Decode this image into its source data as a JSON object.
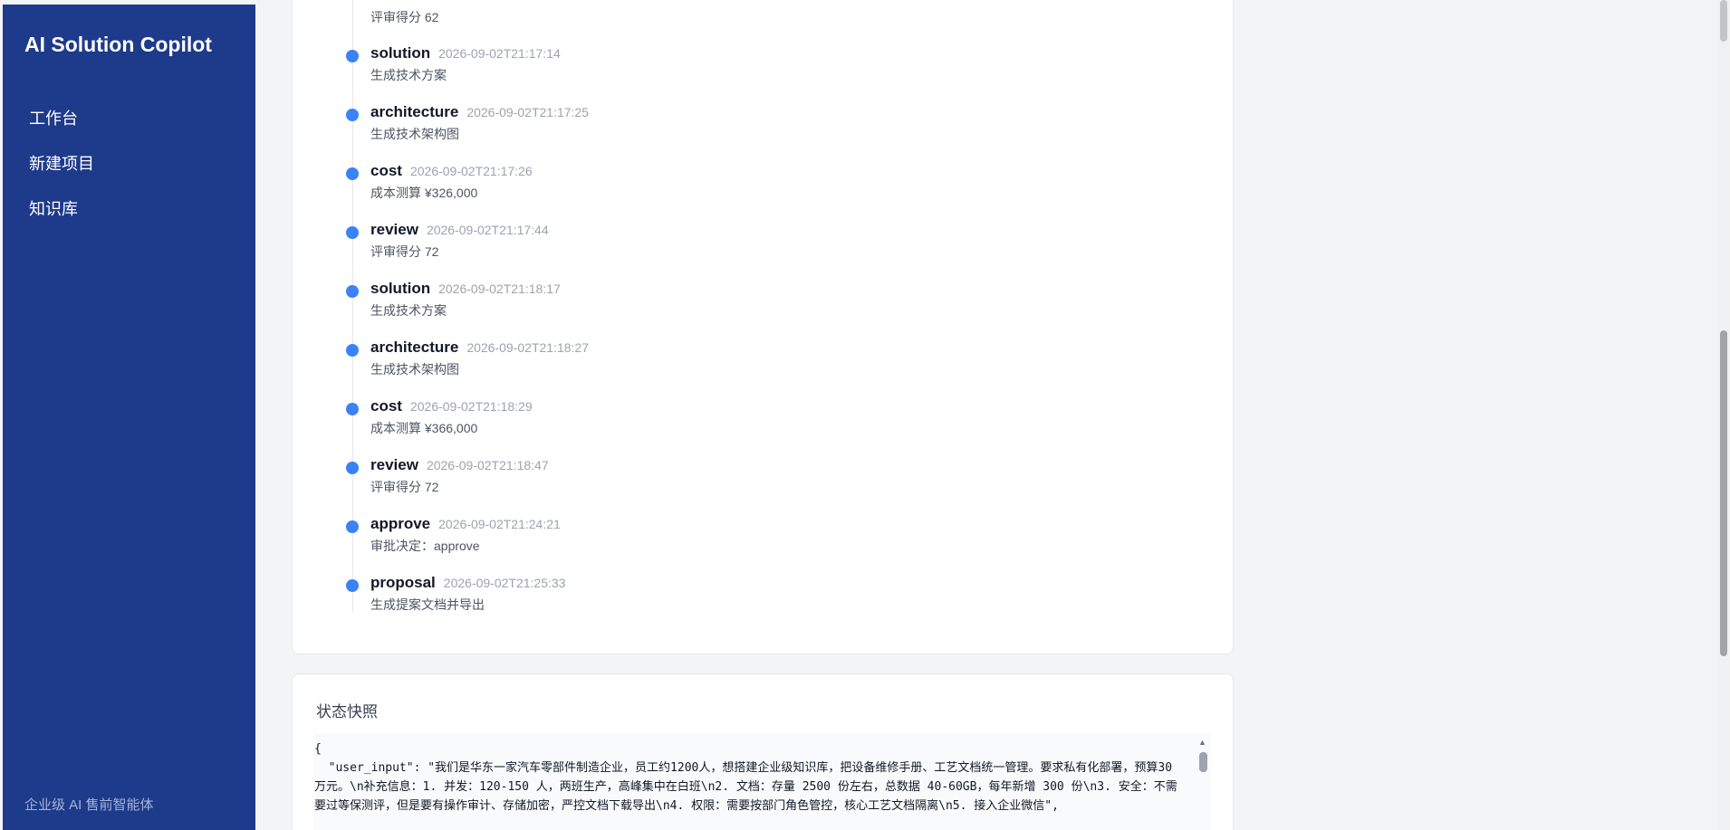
{
  "sidebar": {
    "brand": "AI Solution Copilot",
    "items": [
      {
        "label": "工作台"
      },
      {
        "label": "新建项目"
      },
      {
        "label": "知识库"
      }
    ],
    "footer": "企业级 AI 售前智能体"
  },
  "timeline": {
    "top_desc": "评审得分 62",
    "events": [
      {
        "name": "solution",
        "time": "2026-09-02T21:17:14",
        "desc": "生成技术方案"
      },
      {
        "name": "architecture",
        "time": "2026-09-02T21:17:25",
        "desc": "生成技术架构图"
      },
      {
        "name": "cost",
        "time": "2026-09-02T21:17:26",
        "desc": "成本测算 ¥326,000"
      },
      {
        "name": "review",
        "time": "2026-09-02T21:17:44",
        "desc": "评审得分 72"
      },
      {
        "name": "solution",
        "time": "2026-09-02T21:18:17",
        "desc": "生成技术方案"
      },
      {
        "name": "architecture",
        "time": "2026-09-02T21:18:27",
        "desc": "生成技术架构图"
      },
      {
        "name": "cost",
        "time": "2026-09-02T21:18:29",
        "desc": "成本测算 ¥366,000"
      },
      {
        "name": "review",
        "time": "2026-09-02T21:18:47",
        "desc": "评审得分 72"
      },
      {
        "name": "approve",
        "time": "2026-09-02T21:24:21",
        "desc": "审批决定：approve"
      },
      {
        "name": "proposal",
        "time": "2026-09-02T21:25:33",
        "desc": "生成提案文档并导出"
      }
    ]
  },
  "snapshot": {
    "title": "状态快照",
    "code": "{\n  \"user_input\": \"我们是华东一家汽车零部件制造企业，员工约1200人，想搭建企业级知识库，把设备维修手册、工艺文档统一管理。要求私有化部署，预算30万元。\\n补充信息：1. 并发：120-150 人，两班生产，高峰集中在白班\\n2. 文档：存量 2500 份左右，总数据 40-60GB，每年新增 300 份\\n3. 安全：不需要过等保测评，但是要有操作审计、存储加密，严控文档下载导出\\n4. 权限：需要按部门角色管控，核心工艺文档隔离\\n5. 接入企业微信\","
  },
  "colors": {
    "sidebar_bg": "#1e3a8a",
    "timeline_dot": "#3b82f6"
  }
}
